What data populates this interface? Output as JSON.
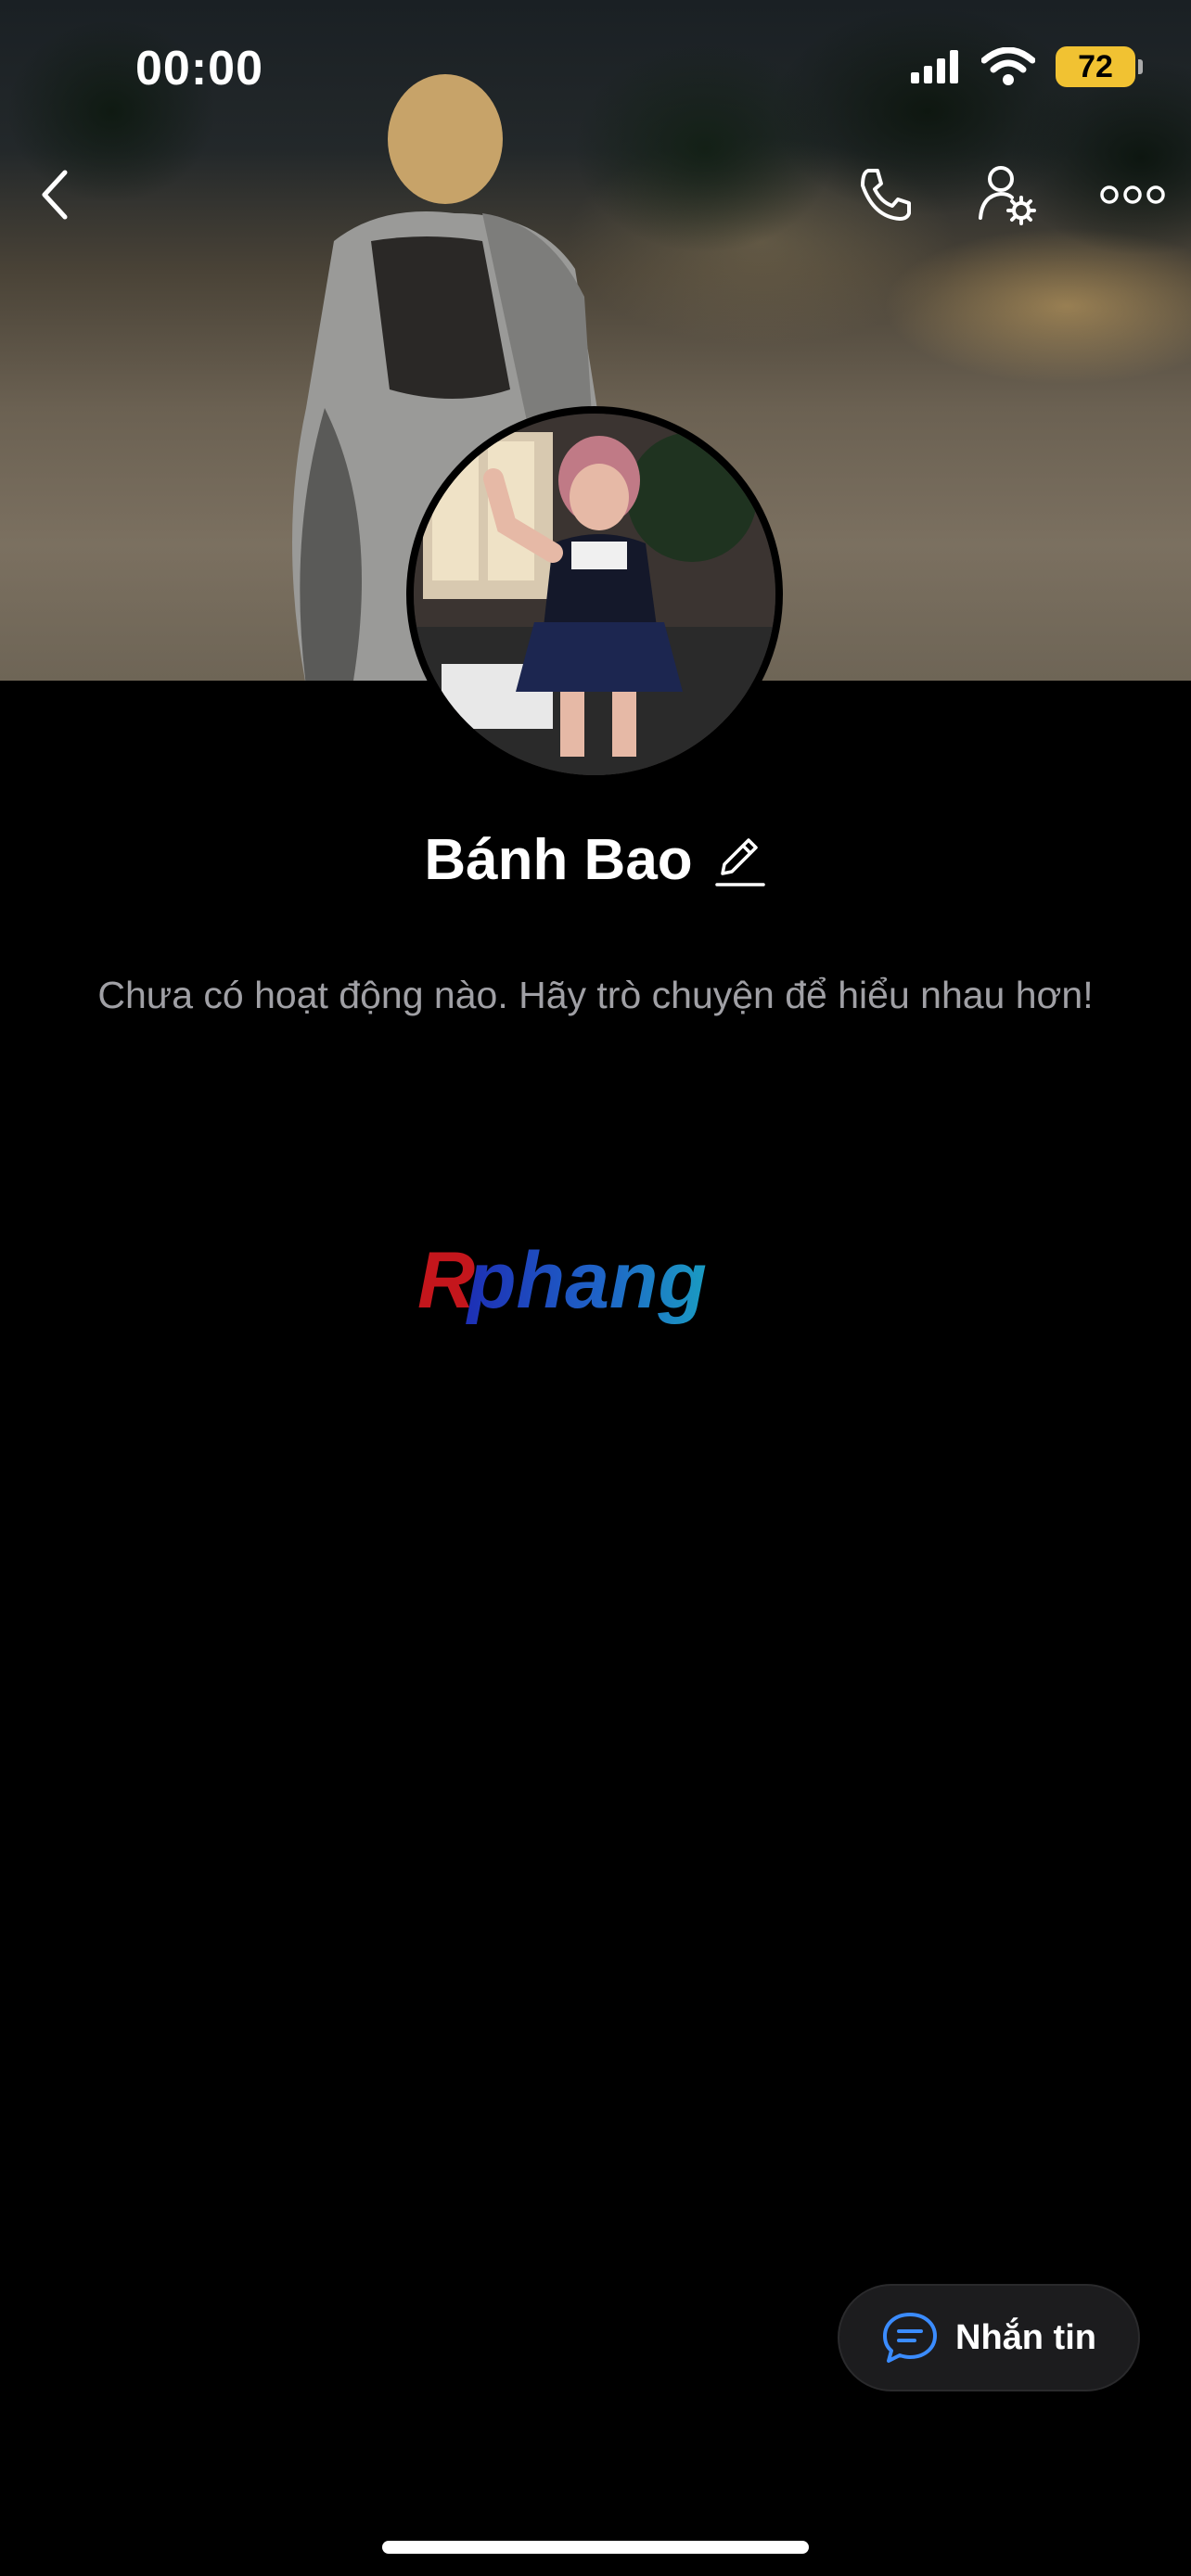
{
  "status_bar": {
    "time": "00:00",
    "battery": "72",
    "battery_color": "#f1c232"
  },
  "header": {
    "back_icon": "chevron-left-icon",
    "call_icon": "phone-icon",
    "settings_icon": "user-settings-icon",
    "more_icon": "more-horizontal-icon"
  },
  "profile": {
    "name": "Bánh Bao",
    "edit_icon": "pencil-icon"
  },
  "feed": {
    "empty_message": "Chưa có hoạt động nào. Hãy trò chuyện để hiểu nhau hơn!"
  },
  "watermark": {
    "first": "R",
    "rest": "phang"
  },
  "fab": {
    "label": "Nhắn tin",
    "icon": "chat-bubble-icon",
    "accent": "#3b8cff"
  }
}
